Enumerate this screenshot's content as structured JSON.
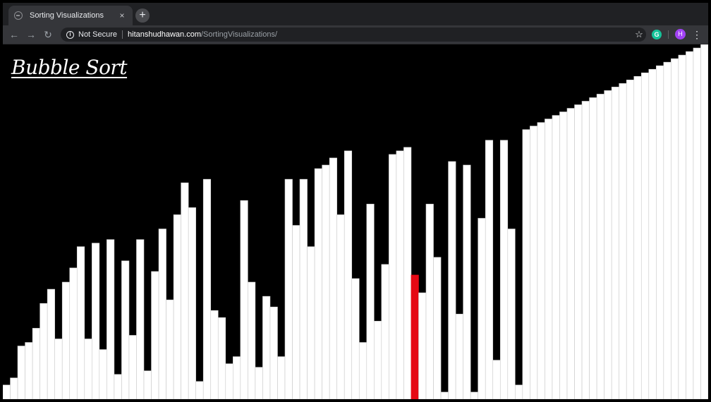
{
  "browser": {
    "tab_title": "Sorting Visualizations",
    "tab_close": "×",
    "new_tab": "+",
    "security_label": "Not Secure",
    "url_host": "hitanshudhawan.com",
    "url_path": "/SortingVisualizations/",
    "nav": {
      "back": "←",
      "forward": "→",
      "reload": "↻"
    },
    "star": "☆",
    "extension_letter": "G",
    "avatar_letter": "H",
    "menu": "⋮"
  },
  "page": {
    "title": "Bubble Sort"
  },
  "colors": {
    "bar": "#ffffff",
    "active_bar": "#e50914",
    "background": "#000000"
  },
  "chart_data": {
    "type": "bar",
    "title": "",
    "ymax": 100,
    "active_index": 55,
    "values": [
      4,
      6,
      15,
      16,
      20,
      27,
      31,
      17,
      33,
      37,
      43,
      17,
      44,
      14,
      45,
      7,
      39,
      18,
      45,
      8,
      36,
      48,
      28,
      52,
      61,
      54,
      5,
      62,
      25,
      23,
      10,
      12,
      56,
      33,
      9,
      29,
      26,
      12,
      62,
      49,
      62,
      43,
      65,
      66,
      68,
      52,
      70,
      34,
      16,
      55,
      22,
      38,
      69,
      70,
      71,
      35,
      30,
      55,
      40,
      2,
      67,
      24,
      66,
      2,
      51,
      73,
      11,
      73,
      48,
      4,
      76,
      77,
      78,
      79,
      80,
      81,
      82,
      83,
      84,
      85,
      86,
      87,
      88,
      89,
      90,
      91,
      92,
      93,
      94,
      95,
      96,
      97,
      98,
      99,
      100
    ]
  }
}
